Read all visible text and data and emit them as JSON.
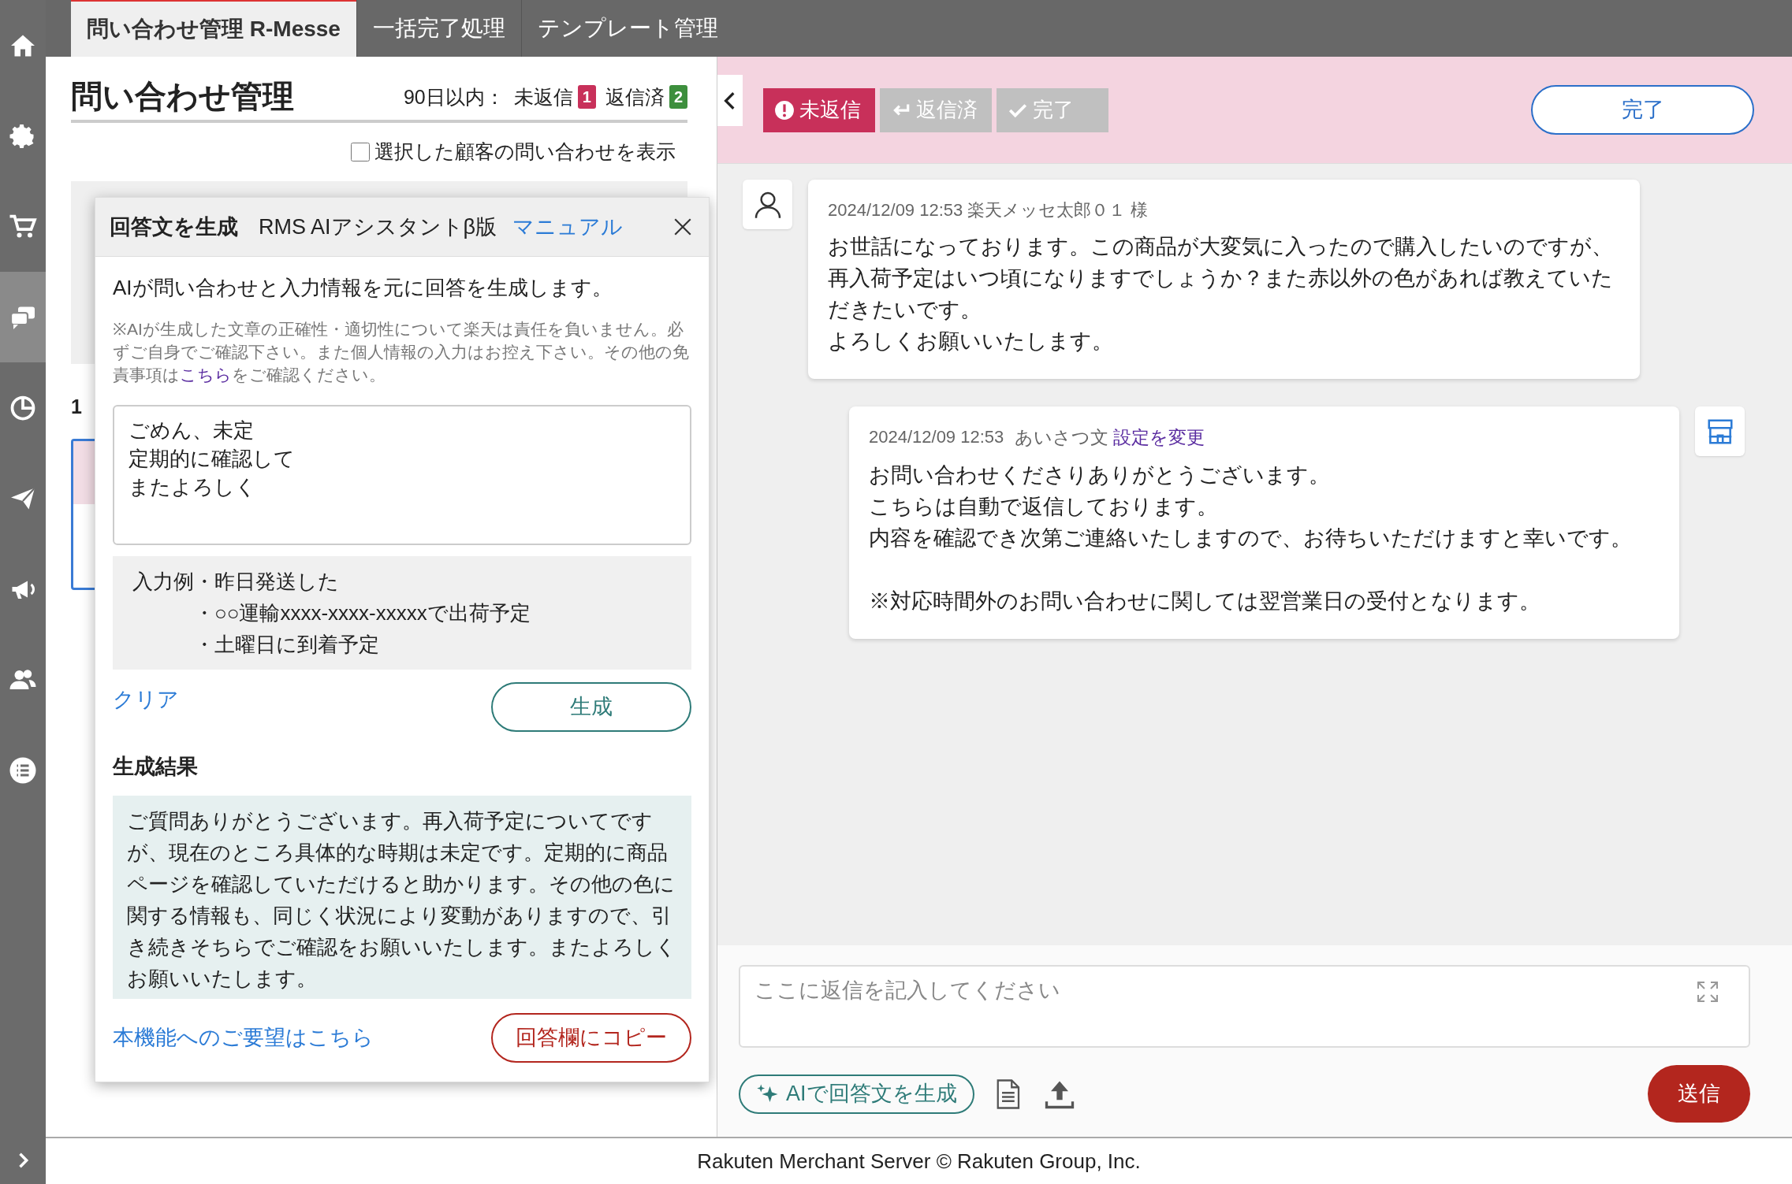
{
  "nav": {
    "items": [
      {
        "selected": false
      },
      {
        "selected": false
      },
      {
        "selected": false
      },
      {
        "selected": true
      },
      {
        "selected": false
      },
      {
        "selected": false
      },
      {
        "selected": false
      },
      {
        "selected": false
      },
      {
        "selected": false
      }
    ]
  },
  "tabs": [
    {
      "label": "問い合わせ管理 R-Messe",
      "selected": true
    },
    {
      "label": "一括完了処理",
      "selected": false
    },
    {
      "label": "テンプレート管理",
      "selected": false
    }
  ],
  "left_panel": {
    "title": "問い合わせ管理",
    "period_label": "90日以内：",
    "counts": [
      {
        "label": "未返信",
        "count": "1",
        "color": "#c8305a"
      },
      {
        "label": "返信済",
        "count": "2",
        "color": "#3d8f3d"
      }
    ],
    "filter_checkbox": {
      "label": "選択した顧客の問い合わせを表示",
      "checked": false
    },
    "list_count": "1"
  },
  "ai_dialog": {
    "title": "回答文を生成",
    "subtitle": "RMS AIアシスタントβ版",
    "manual_link": "マニュアル",
    "description": "AIが問い合わせと入力情報を元に回答を生成します。",
    "disclaimer": {
      "before": "※AIが生成した文章の正確性・適切性について楽天は責任を負いません。必ずご自身でご確認下さい。また個人情報の入力はお控え下さい。その他の免責事項は",
      "link": "こちら",
      "after": "をご確認ください。"
    },
    "input_lines": [
      "ごめん、未定",
      "定期的に確認して",
      "またよろしく"
    ],
    "example_label": "入力例",
    "examples": [
      "・昨日発送した",
      "・○○運輸xxxx-xxxx-xxxxxで出荷予定",
      "・土曜日に到着予定"
    ],
    "clear_link": "クリア",
    "generate_button": "生成",
    "result_heading": "生成結果",
    "result_text": "ご質問ありがとうございます。再入荷予定についてですが、現在のところ具体的な時期は未定です。定期的に商品ページを確認していただけると助かります。その他の色に関する情報も、同じく状況により変動がありますので、引き続きそちらでご確認をお願いいたします。またよろしくお願いいたします。",
    "feedback_link": "本機能へのご要望はこちら",
    "copy_button": "回答欄にコピー"
  },
  "status_buttons": [
    {
      "label": "未返信",
      "selected": true
    },
    {
      "label": "返信済",
      "selected": false
    },
    {
      "label": "完了",
      "selected": false
    }
  ],
  "complete_button": "完了",
  "messages": [
    {
      "kind": "customer",
      "meta": "2024/12/09 12:53 楽天メッセ太郎０１ 様",
      "paragraphs": [
        [
          "お世話になっております。この商品が大変気に入ったので購入したいのですが、",
          "再入荷予定はいつ頃になりますでしょうか？また赤以外の色があれば教えていただきたいです。",
          "よろしくお願いいたします。"
        ]
      ]
    },
    {
      "kind": "shop",
      "meta": "2024/12/09 12:53",
      "label": "あいさつ文",
      "link": "設定を変更",
      "paragraphs": [
        [
          "お問い合わせくださりありがとうございます。",
          "こちらは自動で返信しております。",
          "内容を確認でき次第ご連絡いたしますので、お待ちいただけますと幸いです。"
        ],
        [
          "※対応時間外のお問い合わせに関しては翌営業日の受付となります。"
        ]
      ]
    }
  ],
  "reply": {
    "placeholder": "ここに返信を記入してください",
    "ai_button": "AIで回答文を生成",
    "send_button": "送信"
  },
  "footer": "Rakuten Merchant Server © Rakuten Group, Inc."
}
